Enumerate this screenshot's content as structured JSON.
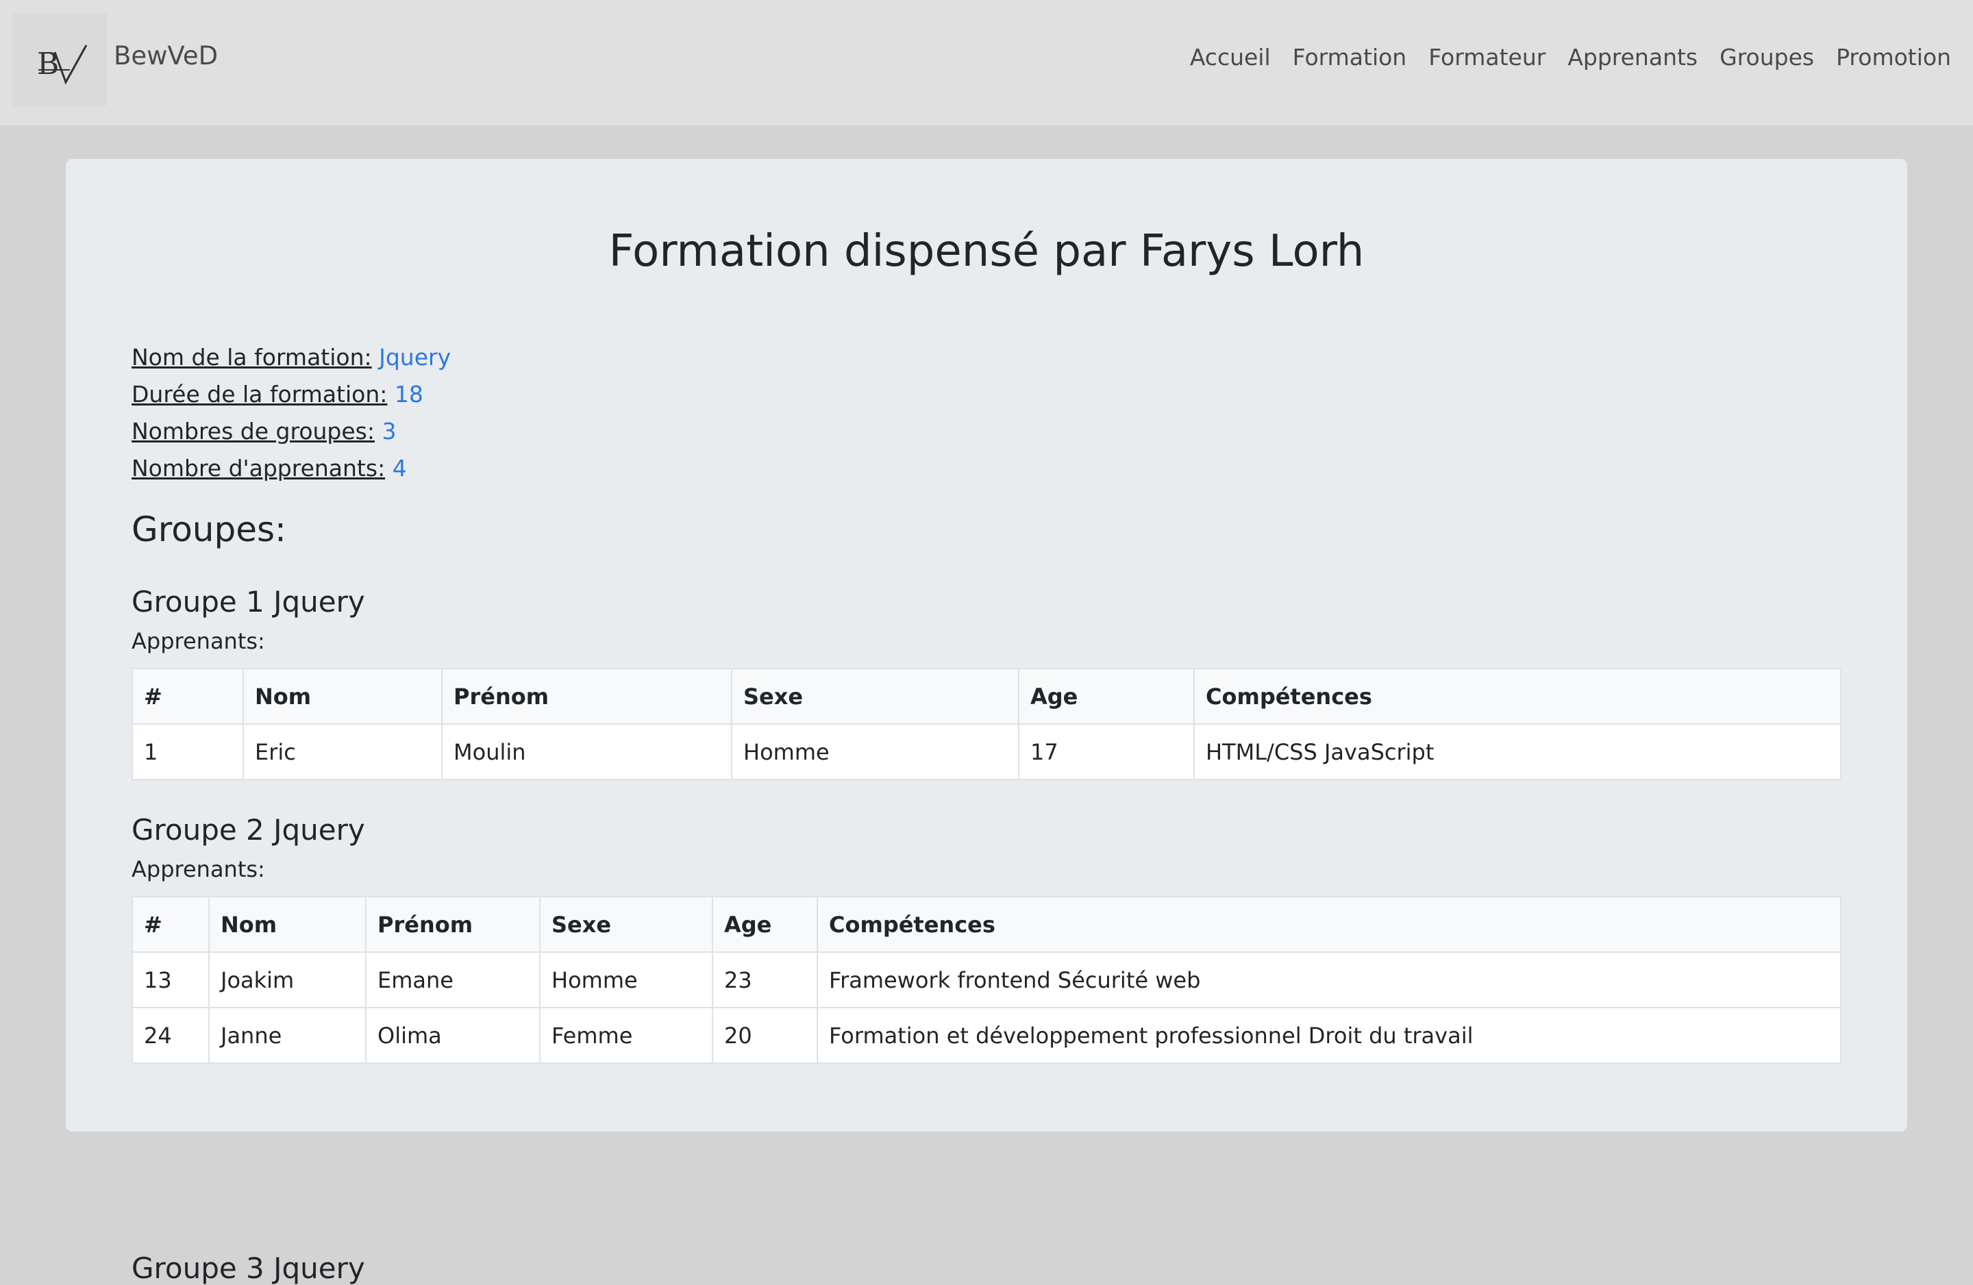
{
  "brand": {
    "name": "BewVeD",
    "logo_text": "BV"
  },
  "nav": [
    "Accueil",
    "Formation",
    "Formateur",
    "Apprenants",
    "Groupes",
    "Promotion"
  ],
  "page_title": "Formation dispensé par Farys Lorh",
  "info": [
    {
      "label": "Nom de la formation:",
      "value": "Jquery"
    },
    {
      "label": "Durée de la formation:",
      "value": "18"
    },
    {
      "label": "Nombres de groupes:",
      "value": "3"
    },
    {
      "label": "Nombre d'apprenants:",
      "value": "4"
    }
  ],
  "groupes_heading": "Groupes:",
  "columns": [
    "#",
    "Nom",
    "Prénom",
    "Sexe",
    "Age",
    "Compétences"
  ],
  "groups": [
    {
      "title": "Groupe 1 Jquery",
      "apprenants_label": "Apprenants:",
      "rows": [
        [
          "1",
          "Eric",
          "Moulin",
          "Homme",
          "17",
          "HTML/CSS JavaScript"
        ]
      ]
    },
    {
      "title": "Groupe 2 Jquery",
      "apprenants_label": "Apprenants:",
      "rows": [
        [
          "13",
          "Joakim",
          "Emane",
          "Homme",
          "23",
          "Framework frontend Sécurité web"
        ],
        [
          "24",
          "Janne",
          "Olima",
          "Femme",
          "20",
          "Formation et développement professionnel Droit du travail"
        ]
      ]
    },
    {
      "title": "Groupe 3 Jquery",
      "apprenants_label": "",
      "rows": []
    }
  ],
  "colors": {
    "accent": "#2b78e4",
    "navbar": "#e0e0e0",
    "card": "#e9ecef"
  }
}
